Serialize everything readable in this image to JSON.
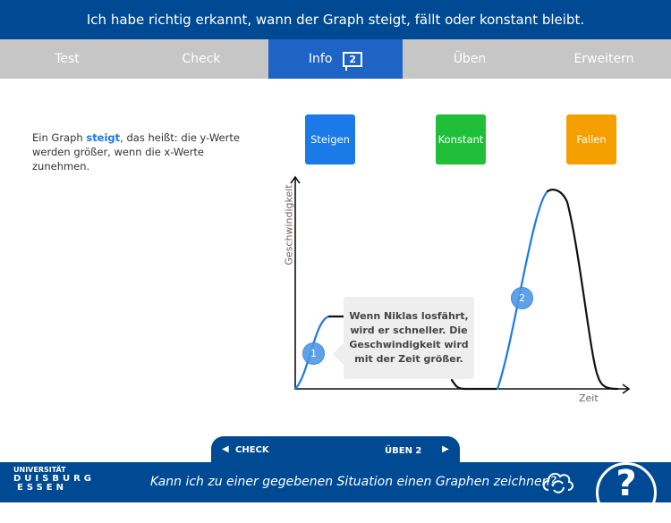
{
  "header": {
    "title": "Ich habe richtig erkannt, wann der Graph steigt, fällt oder konstant bleibt."
  },
  "tabs": [
    {
      "label": "Test"
    },
    {
      "label": "Check"
    },
    {
      "label": "Info",
      "badge": "2",
      "active": true
    },
    {
      "label": "Üben"
    },
    {
      "label": "Erweitern"
    }
  ],
  "info": {
    "before": "Ein Graph ",
    "highlight": "steigt",
    "after": ", das heißt: die y-Werte werden größer, wenn die x-Werte zunehmen."
  },
  "categories": [
    {
      "label": "Steigen",
      "color": "#1a7ae8"
    },
    {
      "label": "Konstant",
      "color": "#1fbf3a"
    },
    {
      "label": "Fallen",
      "color": "#f5a000"
    }
  ],
  "graph": {
    "ylabel": "Geschwindigkeit",
    "xlabel": "Zeit",
    "markers": [
      "1",
      "2"
    ],
    "callout": "Wenn Niklas losfährt, wird er schneller. Die Geschwindigkeit wird mit der Zeit größer.",
    "highlight_color": "#1a7ae8"
  },
  "nav": {
    "prev": "CHECK",
    "next": "ÜBEN 2"
  },
  "footer": {
    "logo_top": "UNIVERSITÄT",
    "logo_mid": "DUISBURG",
    "logo_bottom": "ESSEN",
    "question": "Kann ich zu einer gegebenen Situation einen Graphen zeichnen?",
    "help": "?"
  }
}
